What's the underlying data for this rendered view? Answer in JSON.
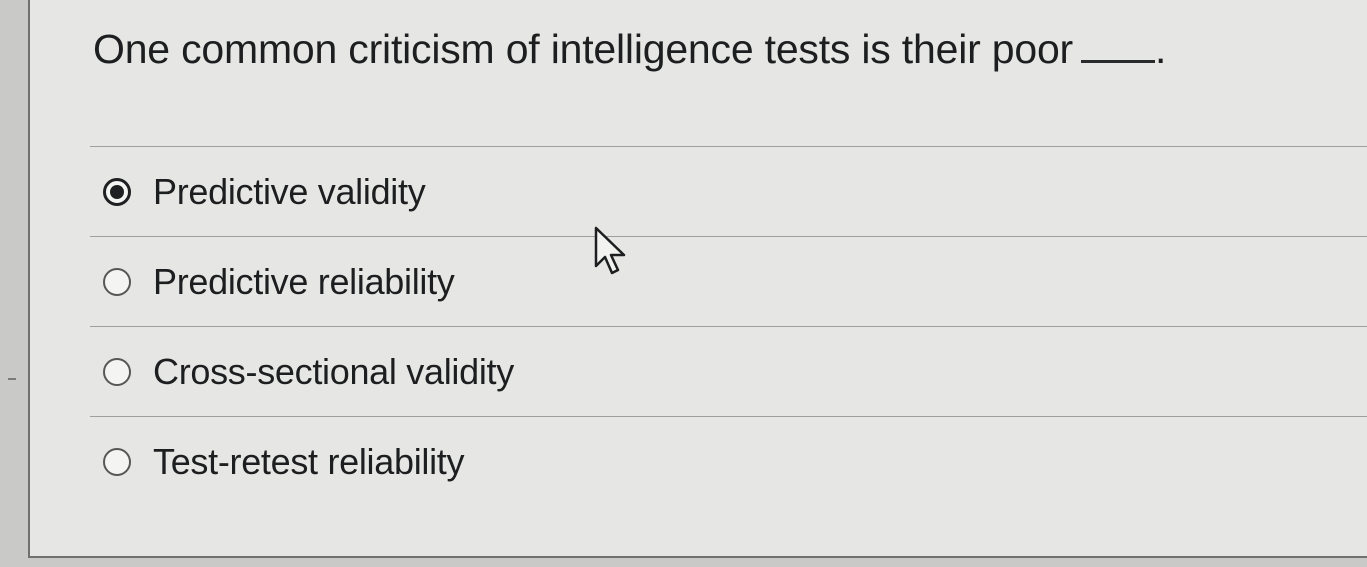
{
  "question": {
    "text": "One common criticism of intelligence tests is their poor",
    "blank_suffix": "."
  },
  "options": [
    {
      "label": "Predictive validity",
      "selected": true
    },
    {
      "label": "Predictive reliability",
      "selected": false
    },
    {
      "label": "Cross-sectional validity",
      "selected": false
    },
    {
      "label": "Test-retest reliability",
      "selected": false
    }
  ],
  "icons": {
    "cursor": "mouse-pointer-icon"
  }
}
